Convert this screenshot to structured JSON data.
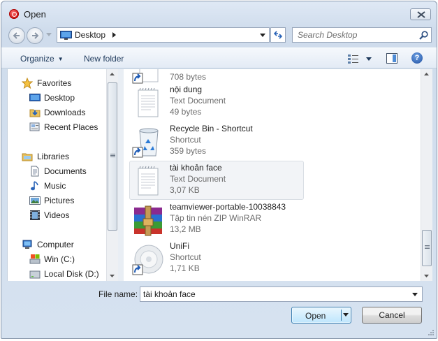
{
  "window": {
    "title": "Open"
  },
  "address": {
    "location": "Desktop"
  },
  "search": {
    "placeholder": "Search Desktop"
  },
  "toolbar": {
    "organize_label": "Organize",
    "new_folder_label": "New folder"
  },
  "nav": {
    "favorites_label": "Favorites",
    "favorites": [
      {
        "label": "Desktop",
        "icon": "desktop-icon"
      },
      {
        "label": "Downloads",
        "icon": "downloads-icon"
      },
      {
        "label": "Recent Places",
        "icon": "recent-places-icon"
      }
    ],
    "libraries_label": "Libraries",
    "libraries": [
      {
        "label": "Documents",
        "icon": "documents-icon"
      },
      {
        "label": "Music",
        "icon": "music-icon"
      },
      {
        "label": "Pictures",
        "icon": "pictures-icon"
      },
      {
        "label": "Videos",
        "icon": "videos-icon"
      }
    ],
    "computer_label": "Computer",
    "drives": [
      {
        "label": "Win (C:)",
        "icon": "drive-c-icon"
      },
      {
        "label": "Local Disk (D:)",
        "icon": "drive-d-icon"
      }
    ]
  },
  "files": [
    {
      "name": "",
      "type": "",
      "size": "708 bytes",
      "icon": "shortcut-file-icon"
    },
    {
      "name": "nội dung",
      "type": "Text Document",
      "size": "49 bytes",
      "icon": "text-document-icon"
    },
    {
      "name": "Recycle Bin - Shortcut",
      "type": "Shortcut",
      "size": "359 bytes",
      "icon": "recycle-bin-icon"
    },
    {
      "name": "tài khoản face",
      "type": "Text Document",
      "size": "3,07 KB",
      "icon": "text-document-icon",
      "selected": true
    },
    {
      "name": "teamviewer-portable-10038843",
      "type": "Tập tin nén ZIP WinRAR",
      "size": "13,2 MB",
      "icon": "winrar-archive-icon"
    },
    {
      "name": "UniFi",
      "type": "Shortcut",
      "size": "1,71 KB",
      "icon": "unifi-shortcut-icon"
    }
  ],
  "file_name": {
    "label": "File name:",
    "value": "tài khoản face"
  },
  "buttons": {
    "open_label": "Open",
    "cancel_label": "Cancel"
  },
  "colors": {
    "selection": "#f2f4f7",
    "link_text": "#1e395b",
    "secondary_text": "#6d6d6d"
  }
}
